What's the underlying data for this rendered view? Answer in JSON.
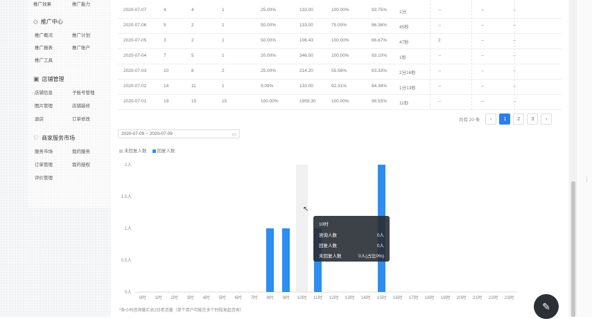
{
  "sidebar": {
    "top_items": [
      {
        "label": "推广效果"
      },
      {
        "label": "推广能力"
      }
    ],
    "sections": [
      {
        "title": "推广中心",
        "icon": "promotion-icon",
        "items": [
          "推广概况",
          "推广计划",
          "推广报表",
          "推广账户",
          "推广工具"
        ]
      },
      {
        "title": "店铺管理",
        "icon": "store-icon",
        "items": [
          "店铺信息",
          "子账号管理",
          "图片管理",
          "店铺装修",
          "退店",
          "订单修改"
        ]
      },
      {
        "title": "商家服务市场",
        "icon": "heart-icon",
        "items": [
          "服务市场",
          "我的服务",
          "订单管理",
          "我的授权",
          "评价管理"
        ]
      }
    ]
  },
  "table": {
    "rows": [
      [
        "2020-07-07",
        "4",
        "4",
        "1",
        "25.00%",
        "133.00",
        "100.00%",
        "93.75%",
        "1分",
        "--",
        "--",
        "--"
      ],
      [
        "2020-07-06",
        "5",
        "2",
        "1",
        "50.00%",
        "133.00",
        "75.00%",
        "86.36%",
        "45秒",
        "--",
        "--",
        "--"
      ],
      [
        "2020-07-05",
        "3",
        "2",
        "1",
        "50.00%",
        "106.43",
        "100.00%",
        "66.67%",
        "47秒",
        "2",
        "--",
        "--"
      ],
      [
        "2020-07-04",
        "7",
        "5",
        "1",
        "20.00%",
        "346.00",
        "100.00%",
        "93.10%",
        "1秒",
        "--",
        "--",
        "--"
      ],
      [
        "2020-07-03",
        "10",
        "8",
        "2",
        "25.00%",
        "214.20",
        "55.56%",
        "83.33%",
        "2分16秒",
        "--",
        "--",
        "--"
      ],
      [
        "2020-07-02",
        "14",
        "11",
        "1",
        "9.09%",
        "133.00",
        "92.31%",
        "84.38%",
        "1分13秒",
        "--",
        "--",
        "--"
      ],
      [
        "2020-07-01",
        "19",
        "15",
        "15",
        "100.00%",
        "1959.30",
        "100.00%",
        "96.55%",
        "11秒",
        "--",
        "--",
        "--"
      ]
    ]
  },
  "pagination": {
    "total": "共有 20 条",
    "prev": "‹",
    "pages": [
      "1",
      "2",
      "3"
    ],
    "next": "›",
    "active": "1"
  },
  "date_range": {
    "value": "2020-07-09 ~ 2020-07-09",
    "icon": "calendar-icon"
  },
  "chart_data": {
    "type": "bar",
    "legend_position": "top-left",
    "categories": [
      "0时",
      "1时",
      "2时",
      "3时",
      "4时",
      "5时",
      "6时",
      "7时",
      "8时",
      "9时",
      "10时",
      "11时",
      "12时",
      "13时",
      "14时",
      "15时",
      "16时",
      "17时",
      "18时",
      "19时",
      "20时",
      "21时",
      "22时",
      "23时"
    ],
    "series": [
      {
        "name": "未回复人数",
        "color": "#cccccc",
        "values": [
          0,
          0,
          0,
          0,
          0,
          0,
          0,
          0,
          0,
          0,
          0,
          0,
          0,
          0,
          0,
          0,
          0,
          0,
          0,
          0,
          0,
          0,
          0,
          0
        ]
      },
      {
        "name": "回复人数",
        "color": "#2c8ef0",
        "values": [
          0,
          0,
          0,
          0,
          0,
          0,
          0,
          0,
          1,
          1,
          0,
          1,
          0,
          0,
          0,
          2,
          0,
          0,
          0,
          0,
          0,
          0,
          0,
          0
        ]
      }
    ],
    "ytick_labels": [
      "0人",
      "0.5人",
      "1人",
      "1.5人",
      "2人"
    ],
    "ylim": [
      0,
      2
    ],
    "grid": false
  },
  "tooltip": {
    "title": "10时",
    "rows": [
      {
        "label": "咨询人数",
        "value": "0人"
      },
      {
        "label": "回复人数",
        "value": "0人"
      },
      {
        "label": "未回复人数",
        "value": "0人(占比0%)"
      }
    ]
  },
  "footnote": "*各小时咨询量汇总2日老咨量（单个用户可能在多个时段发起咨询）",
  "fab_icon": "edit-icon"
}
